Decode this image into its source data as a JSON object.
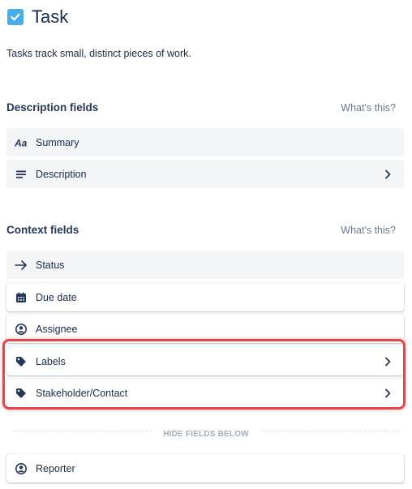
{
  "issue_type": {
    "title": "Task",
    "description": "Tasks track small, distinct pieces of work."
  },
  "description_fields": {
    "heading": "Description fields",
    "help_link": "What's this?",
    "items": [
      {
        "label": "Summary",
        "icon": "text-format-icon"
      },
      {
        "label": "Description",
        "icon": "paragraph-lines-icon"
      }
    ]
  },
  "context_fields": {
    "heading": "Context fields",
    "help_link": "What's this?",
    "items": [
      {
        "label": "Status",
        "icon": "arrow-right-icon"
      },
      {
        "label": "Due date",
        "icon": "calendar-icon"
      },
      {
        "label": "Assignee",
        "icon": "person-circle-icon"
      },
      {
        "label": "Labels",
        "icon": "tag-icon"
      },
      {
        "label": "Stakeholder/Contact",
        "icon": "tag-icon"
      }
    ]
  },
  "hide_divider": {
    "label": "HIDE FIELDS BELOW"
  },
  "hidden_fields": {
    "items": [
      {
        "label": "Reporter",
        "icon": "person-circle-icon"
      }
    ]
  },
  "colors": {
    "task_icon": "#4bade8",
    "highlight_border": "#e3474a",
    "grey_row": "#f4f5f7",
    "text": "#172b4d",
    "muted": "#6b778c"
  }
}
